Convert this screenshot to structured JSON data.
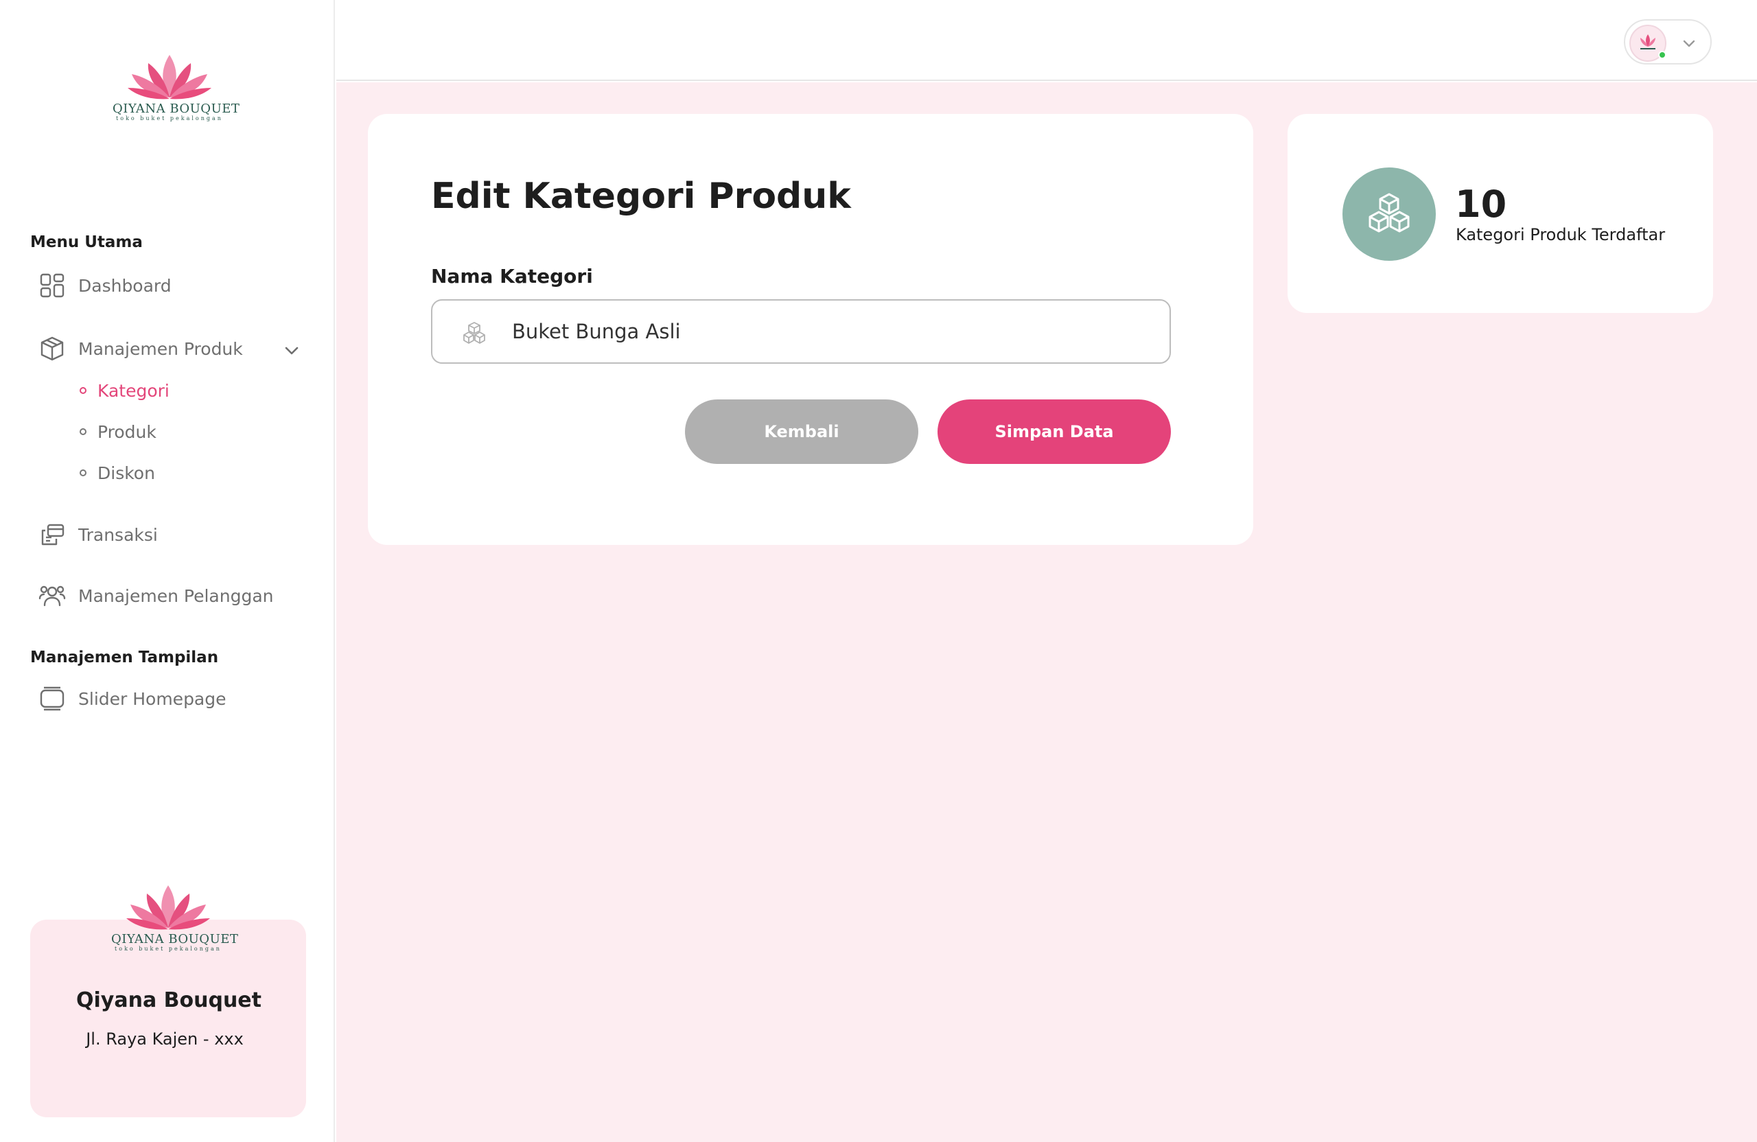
{
  "brand": {
    "logo_text": "QIYANA BOUQUET",
    "logo_tagline": "toko buket pekalongan"
  },
  "sidebar": {
    "section_main": "Menu Utama",
    "section_display": "Manajemen Tampilan",
    "items": [
      {
        "label": "Dashboard",
        "icon": "dashboard-grid-icon"
      },
      {
        "label": "Manajemen Produk",
        "icon": "box-icon",
        "expanded": true
      },
      {
        "label": "Transaksi",
        "icon": "transaction-icon"
      },
      {
        "label": "Manajemen Pelanggan",
        "icon": "users-icon"
      },
      {
        "label": "Slider Homepage",
        "icon": "slider-icon"
      }
    ],
    "sub_items": [
      {
        "label": "Kategori",
        "active": true
      },
      {
        "label": "Produk",
        "active": false
      },
      {
        "label": "Diskon",
        "active": false
      }
    ],
    "store": {
      "name": "Qiyana Bouquet",
      "address": "Jl. Raya Kajen - xxx"
    }
  },
  "form": {
    "title": "Edit Kategori Produk",
    "field_label": "Nama Kategori",
    "field_value": "Buket Bunga Asli",
    "back_label": "Kembali",
    "save_label": "Simpan Data"
  },
  "stat": {
    "count": "10",
    "label": "Kategori Produk Terdaftar"
  },
  "colors": {
    "accent": "#e4437a",
    "main_bg": "#fdedf1",
    "stat_circle": "#8db6ab",
    "button_secondary": "#b0b0b0",
    "online": "#37c34f"
  }
}
